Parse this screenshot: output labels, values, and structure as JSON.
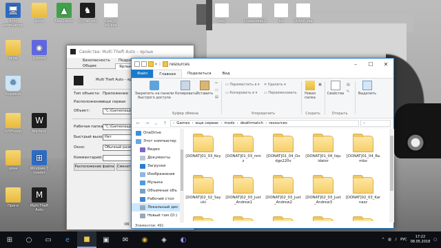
{
  "desktop": {
    "left_icons": [
      {
        "id": "computer",
        "label": "Этот компьютер",
        "kind": "pc",
        "glyph": "🖥"
      },
      {
        "id": "photo",
        "label": "фото",
        "kind": "folder",
        "glyph": ""
      },
      {
        "id": "bluestacks",
        "label": "BlueStacks",
        "kind": "green",
        "glyph": "▲"
      },
      {
        "id": "uydnr",
        "label": "UyDNR e6c",
        "kind": "dark",
        "glyph": "♞"
      },
      {
        "id": "cleo",
        "label": "Cleo (f) d9.exe",
        "kind": "doc",
        "glyph": ""
      },
      {
        "id": "games",
        "label": "игры",
        "kind": "folder",
        "glyph": ""
      },
      {
        "id": "discord",
        "label": "Discord",
        "kind": "purple",
        "glyph": "◉"
      },
      {
        "id": "bin",
        "label": "Корзина",
        "kind": "bin",
        "glyph": "♻"
      },
      {
        "id": "gta",
        "label": "020Fuxpp",
        "kind": "folder",
        "glyph": ""
      },
      {
        "id": "warface",
        "label": "Warface",
        "kind": "dark",
        "glyph": "W"
      },
      {
        "id": "docs",
        "label": "доки",
        "kind": "folder",
        "glyph": ""
      },
      {
        "id": "windows",
        "label": "Windows 7 Loader",
        "kind": "blue",
        "glyph": "⊞"
      },
      {
        "id": "progi",
        "label": "Проги",
        "kind": "folder",
        "glyph": ""
      },
      {
        "id": "mta",
        "label": "Multi Theft Auto",
        "kind": "dark",
        "glyph": "M"
      }
    ],
    "top_icons": [
      {
        "id": "t1",
        "label": "мод"
      },
      {
        "id": "t2",
        "label": "Loadscreen1"
      },
      {
        "id": "t3",
        "label": "ios"
      },
      {
        "id": "t4",
        "label": "UnRAR.exe"
      }
    ]
  },
  "properties_dialog": {
    "title": "Свойства: Multi Theft Auto – ярлык",
    "tabs": [
      "Безопасность",
      "Подробно",
      "Общие",
      "Ярлык"
    ],
    "shortcut_name": "Multi Theft Auto – ярлык",
    "rows": [
      {
        "label": "Тип объекта:",
        "value": "Приложение"
      },
      {
        "label": "Расположение:",
        "value": "еще сервак"
      },
      {
        "label": "Объект:",
        "value": "\"C:\\Games\\еще серв"
      },
      {
        "label": "Рабочая папка:",
        "value": "\"C:\\Games\\еще с"
      },
      {
        "label": "Быстрый вызов:",
        "value": "Нет"
      },
      {
        "label": "Окно:",
        "value": "Обычный размер о"
      },
      {
        "label": "Комментарий:",
        "value": ""
      }
    ],
    "buttons": {
      "location": "Расположение файла",
      "change_icon": "Сменить и",
      "ok": "OK"
    }
  },
  "explorer": {
    "title": "resources",
    "tabs": {
      "file": "Файл",
      "home": "Главная",
      "share": "Поделиться",
      "view": "Вид"
    },
    "ribbon": {
      "pin": "Закрепить на панели быстрого доступа",
      "copy": "Копировать",
      "paste": "Вставить",
      "move": "Переместить в",
      "copy_to": "Копировать в",
      "delete": "Удалить",
      "rename": "Переименовать",
      "new_folder": "Новая папка",
      "properties": "Свойства",
      "select": "Выделить",
      "group_clipboard": "Буфер обмена",
      "group_organize": "Упорядочить",
      "group_create": "Создать",
      "group_open": "Открыть"
    },
    "breadcrumb": [
      "Games",
      "еще сервак",
      "mods",
      "deathmatch",
      "resources"
    ],
    "nav": [
      {
        "label": "OneDrive",
        "color": "#3a8fe0",
        "sel": false
      },
      {
        "label": "Этот компьютер",
        "color": "#6aa8e0",
        "sel": false
      },
      {
        "label": "Видео",
        "color": "#7b68c9",
        "sel": false
      },
      {
        "label": "Документы",
        "color": "#b7c4d3",
        "sel": false
      },
      {
        "label": "Загрузки",
        "color": "#2a7cd6",
        "sel": false
      },
      {
        "label": "Изображения",
        "color": "#8fb7e4",
        "sel": false
      },
      {
        "label": "Музыка",
        "color": "#4c9be0",
        "sel": false
      },
      {
        "label": "Объемные объ",
        "color": "#7aa0c7",
        "sel": false
      },
      {
        "label": "Рабочий стол",
        "color": "#3f84d0",
        "sel": false
      },
      {
        "label": "Локальный дис",
        "color": "#9aa7b5",
        "sel": true
      },
      {
        "label": "Новый том (D:)",
        "color": "#9aa7b5",
        "sel": false
      },
      {
        "label": "Локальный диск",
        "color": "#9aa7b5",
        "sel": false
      }
    ],
    "folders": [
      "[DONAT]01_03_Key",
      "[DONAT]01_03_nmiz",
      "[DONAT]01_04_Dodge220v",
      "[DONAT]01_04_liquidator",
      "[DONAT]01_04_Rambo",
      "[DONAT]02_02_Sayuki",
      "[DONAT]02_03_Just_Andrew1",
      "[DONAT]02_03_Just_Andrew2",
      "[DONAT]02_03_Just_Andrew3",
      "[DONAT]02_03_Karnazz",
      "",
      "",
      "",
      "",
      ""
    ],
    "status": "Элементов: 491"
  },
  "taskbar": {
    "lang": "РУС",
    "time": "17:22",
    "date": "08.05.2018"
  }
}
